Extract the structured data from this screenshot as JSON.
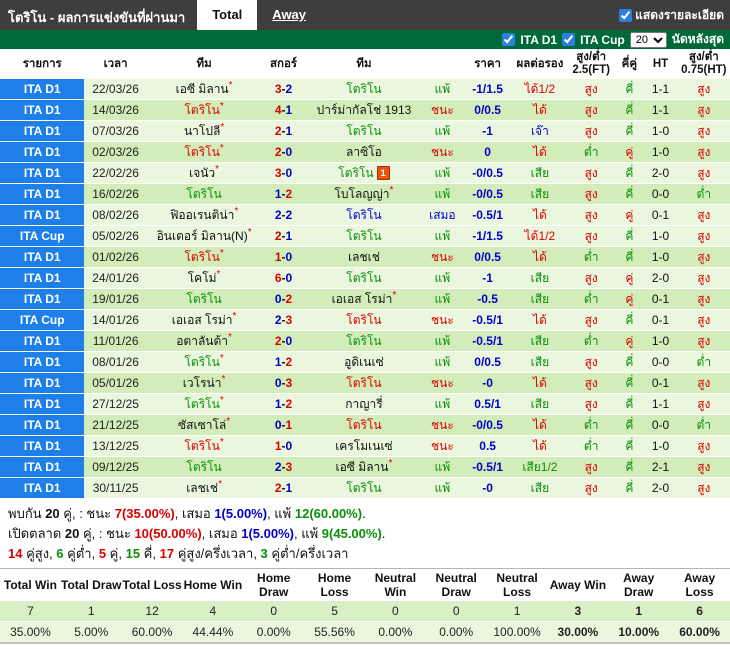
{
  "meta": {
    "star": "*",
    "dash": "-"
  },
  "header": {
    "title": "โตริโน - ผลการแข่งขันที่ผ่านมา",
    "tabs": [
      {
        "label": "Total",
        "active": true
      },
      {
        "label": "Away",
        "active": false
      }
    ],
    "details_checkbox_label": "แสดงรายละเอียด"
  },
  "filter": {
    "leagues": [
      {
        "label": "ITA D1",
        "checked": true
      },
      {
        "label": "ITA Cup",
        "checked": true
      }
    ],
    "count": "20",
    "count_suffix": "นัดหลังสุด"
  },
  "table": {
    "headers": [
      "รายการ",
      "เวลา",
      "ทีม",
      "สกอร์",
      "ทีม",
      "",
      "ราคา",
      "ผลต่อรอง",
      "สูง/ต่ำ 2.5(FT)",
      "คี่คู่",
      "HT",
      "สูง/ต่ำ 0.75(HT)"
    ],
    "rows": [
      {
        "lg": "ITA D1",
        "dt": "22/03/26",
        "h": {
          "n": "เอซี มิลาน",
          "st": 1,
          "c": "k"
        },
        "s": {
          "h": "3",
          "a": "2",
          "hc": "r",
          "ac": "b"
        },
        "a": {
          "n": "โตริโน",
          "c": "g"
        },
        "rw": {
          "t": "แพ้",
          "c": "g"
        },
        "od": "-1/1.5",
        "hd": {
          "t": "ได้1/2",
          "c": "r"
        },
        "ou": {
          "t": "สูง",
          "c": "r"
        },
        "oe": {
          "t": "คี่",
          "c": "g"
        },
        "ht": "1-1",
        "oh": {
          "t": "สูง",
          "c": "r"
        }
      },
      {
        "lg": "ITA D1",
        "dt": "14/03/26",
        "h": {
          "n": "โตริโน",
          "st": 1,
          "c": "r"
        },
        "s": {
          "h": "4",
          "a": "1",
          "hc": "r",
          "ac": "b"
        },
        "a": {
          "n": "ปาร์ม่ากัลโช่ 1913",
          "c": "k"
        },
        "rw": {
          "t": "ชนะ",
          "c": "r"
        },
        "od": "0/0.5",
        "hd": {
          "t": "ได้",
          "c": "r"
        },
        "ou": {
          "t": "สูง",
          "c": "r"
        },
        "oe": {
          "t": "คี่",
          "c": "g"
        },
        "ht": "1-1",
        "oh": {
          "t": "สูง",
          "c": "r"
        }
      },
      {
        "lg": "ITA D1",
        "dt": "07/03/26",
        "h": {
          "n": "นาโปลี",
          "st": 1,
          "c": "k"
        },
        "s": {
          "h": "2",
          "a": "1",
          "hc": "r",
          "ac": "b"
        },
        "a": {
          "n": "โตริโน",
          "c": "g"
        },
        "rw": {
          "t": "แพ้",
          "c": "g"
        },
        "od": "-1",
        "hd": {
          "t": "เจ๊า",
          "c": "b"
        },
        "ou": {
          "t": "สูง",
          "c": "r"
        },
        "oe": {
          "t": "คี่",
          "c": "g"
        },
        "ht": "1-0",
        "oh": {
          "t": "สูง",
          "c": "r"
        }
      },
      {
        "lg": "ITA D1",
        "dt": "02/03/26",
        "h": {
          "n": "โตริโน",
          "st": 1,
          "c": "r"
        },
        "s": {
          "h": "2",
          "a": "0",
          "hc": "r",
          "ac": "b"
        },
        "a": {
          "n": "ลาซิโอ",
          "c": "k"
        },
        "rw": {
          "t": "ชนะ",
          "c": "r"
        },
        "od": "0",
        "hd": {
          "t": "ได้",
          "c": "r"
        },
        "ou": {
          "t": "ต่ำ",
          "c": "g"
        },
        "oe": {
          "t": "คู่",
          "c": "r"
        },
        "ht": "1-0",
        "oh": {
          "t": "สูง",
          "c": "r"
        }
      },
      {
        "lg": "ITA D1",
        "dt": "22/02/26",
        "h": {
          "n": "เจนัว",
          "st": 1,
          "c": "k"
        },
        "s": {
          "h": "3",
          "a": "0",
          "hc": "r",
          "ac": "b"
        },
        "a": {
          "n": "โตริโน",
          "c": "g",
          "card": "1"
        },
        "rw": {
          "t": "แพ้",
          "c": "g"
        },
        "od": "-0/0.5",
        "hd": {
          "t": "เสีย",
          "c": "g"
        },
        "ou": {
          "t": "สูง",
          "c": "r"
        },
        "oe": {
          "t": "คี่",
          "c": "g"
        },
        "ht": "2-0",
        "oh": {
          "t": "สูง",
          "c": "r"
        }
      },
      {
        "lg": "ITA D1",
        "dt": "16/02/26",
        "h": {
          "n": "โตริโน",
          "c": "g"
        },
        "s": {
          "h": "1",
          "a": "2",
          "hc": "b",
          "ac": "r"
        },
        "a": {
          "n": "โบโลญญ่า",
          "st": 1,
          "c": "k"
        },
        "rw": {
          "t": "แพ้",
          "c": "g"
        },
        "od": "-0/0.5",
        "hd": {
          "t": "เสีย",
          "c": "g"
        },
        "ou": {
          "t": "สูง",
          "c": "r"
        },
        "oe": {
          "t": "คี่",
          "c": "g"
        },
        "ht": "0-0",
        "oh": {
          "t": "ต่ำ",
          "c": "g"
        }
      },
      {
        "lg": "ITA D1",
        "dt": "08/02/26",
        "h": {
          "n": "ฟิออเรนติน่า",
          "st": 1,
          "c": "k"
        },
        "s": {
          "h": "2",
          "a": "2",
          "hc": "b",
          "ac": "b"
        },
        "a": {
          "n": "โตริโน",
          "c": "b"
        },
        "rw": {
          "t": "เสมอ",
          "c": "b"
        },
        "od": "-0.5/1",
        "hd": {
          "t": "ได้",
          "c": "r"
        },
        "ou": {
          "t": "สูง",
          "c": "r"
        },
        "oe": {
          "t": "คู่",
          "c": "r"
        },
        "ht": "0-1",
        "oh": {
          "t": "สูง",
          "c": "r"
        }
      },
      {
        "lg": "ITA Cup",
        "dt": "05/02/26",
        "h": {
          "n": "อินเตอร์ มิลาน(N)",
          "st": 1,
          "c": "k"
        },
        "s": {
          "h": "2",
          "a": "1",
          "hc": "r",
          "ac": "b"
        },
        "a": {
          "n": "โตริโน",
          "c": "g"
        },
        "rw": {
          "t": "แพ้",
          "c": "g"
        },
        "od": "-1/1.5",
        "hd": {
          "t": "ได้1/2",
          "c": "r"
        },
        "ou": {
          "t": "สูง",
          "c": "r"
        },
        "oe": {
          "t": "คี่",
          "c": "g"
        },
        "ht": "1-0",
        "oh": {
          "t": "สูง",
          "c": "r"
        }
      },
      {
        "lg": "ITA D1",
        "dt": "01/02/26",
        "h": {
          "n": "โตริโน",
          "st": 1,
          "c": "r"
        },
        "s": {
          "h": "1",
          "a": "0",
          "hc": "r",
          "ac": "b"
        },
        "a": {
          "n": "เลชเช่",
          "c": "k"
        },
        "rw": {
          "t": "ชนะ",
          "c": "r"
        },
        "od": "0/0.5",
        "hd": {
          "t": "ได้",
          "c": "r"
        },
        "ou": {
          "t": "ต่ำ",
          "c": "g"
        },
        "oe": {
          "t": "คี่",
          "c": "g"
        },
        "ht": "1-0",
        "oh": {
          "t": "สูง",
          "c": "r"
        }
      },
      {
        "lg": "ITA D1",
        "dt": "24/01/26",
        "h": {
          "n": "โคโม่",
          "st": 1,
          "c": "k"
        },
        "s": {
          "h": "6",
          "a": "0",
          "hc": "r",
          "ac": "b"
        },
        "a": {
          "n": "โตริโน",
          "c": "g"
        },
        "rw": {
          "t": "แพ้",
          "c": "g"
        },
        "od": "-1",
        "hd": {
          "t": "เสีย",
          "c": "g"
        },
        "ou": {
          "t": "สูง",
          "c": "r"
        },
        "oe": {
          "t": "คู่",
          "c": "r"
        },
        "ht": "2-0",
        "oh": {
          "t": "สูง",
          "c": "r"
        }
      },
      {
        "lg": "ITA D1",
        "dt": "19/01/26",
        "h": {
          "n": "โตริโน",
          "c": "g"
        },
        "s": {
          "h": "0",
          "a": "2",
          "hc": "b",
          "ac": "r"
        },
        "a": {
          "n": "เอเอส โรม่า",
          "st": 1,
          "c": "k"
        },
        "rw": {
          "t": "แพ้",
          "c": "g"
        },
        "od": "-0.5",
        "hd": {
          "t": "เสีย",
          "c": "g"
        },
        "ou": {
          "t": "ต่ำ",
          "c": "g"
        },
        "oe": {
          "t": "คู่",
          "c": "r"
        },
        "ht": "0-1",
        "oh": {
          "t": "สูง",
          "c": "r"
        }
      },
      {
        "lg": "ITA Cup",
        "dt": "14/01/26",
        "h": {
          "n": "เอเอส โรม่า",
          "st": 1,
          "c": "k"
        },
        "s": {
          "h": "2",
          "a": "3",
          "hc": "b",
          "ac": "r"
        },
        "a": {
          "n": "โตริโน",
          "c": "r"
        },
        "rw": {
          "t": "ชนะ",
          "c": "r"
        },
        "od": "-0.5/1",
        "hd": {
          "t": "ได้",
          "c": "r"
        },
        "ou": {
          "t": "สูง",
          "c": "r"
        },
        "oe": {
          "t": "คี่",
          "c": "g"
        },
        "ht": "0-1",
        "oh": {
          "t": "สูง",
          "c": "r"
        }
      },
      {
        "lg": "ITA D1",
        "dt": "11/01/26",
        "h": {
          "n": "อตาลันต้า",
          "st": 1,
          "c": "k"
        },
        "s": {
          "h": "2",
          "a": "0",
          "hc": "r",
          "ac": "b"
        },
        "a": {
          "n": "โตริโน",
          "c": "g"
        },
        "rw": {
          "t": "แพ้",
          "c": "g"
        },
        "od": "-0.5/1",
        "hd": {
          "t": "เสีย",
          "c": "g"
        },
        "ou": {
          "t": "ต่ำ",
          "c": "g"
        },
        "oe": {
          "t": "คู่",
          "c": "r"
        },
        "ht": "1-0",
        "oh": {
          "t": "สูง",
          "c": "r"
        }
      },
      {
        "lg": "ITA D1",
        "dt": "08/01/26",
        "h": {
          "n": "โตริโน",
          "st": 1,
          "c": "g"
        },
        "s": {
          "h": "1",
          "a": "2",
          "hc": "b",
          "ac": "r"
        },
        "a": {
          "n": "อูดิเนเซ่",
          "c": "k"
        },
        "rw": {
          "t": "แพ้",
          "c": "g"
        },
        "od": "0/0.5",
        "hd": {
          "t": "เสีย",
          "c": "g"
        },
        "ou": {
          "t": "สูง",
          "c": "r"
        },
        "oe": {
          "t": "คี่",
          "c": "g"
        },
        "ht": "0-0",
        "oh": {
          "t": "ต่ำ",
          "c": "g"
        }
      },
      {
        "lg": "ITA D1",
        "dt": "05/01/26",
        "h": {
          "n": "เวโรน่า",
          "st": 1,
          "c": "k"
        },
        "s": {
          "h": "0",
          "a": "3",
          "hc": "b",
          "ac": "r"
        },
        "a": {
          "n": "โตริโน",
          "c": "r"
        },
        "rw": {
          "t": "ชนะ",
          "c": "r"
        },
        "od": "-0",
        "hd": {
          "t": "ได้",
          "c": "r"
        },
        "ou": {
          "t": "สูง",
          "c": "r"
        },
        "oe": {
          "t": "คี่",
          "c": "g"
        },
        "ht": "0-1",
        "oh": {
          "t": "สูง",
          "c": "r"
        }
      },
      {
        "lg": "ITA D1",
        "dt": "27/12/25",
        "h": {
          "n": "โตริโน",
          "st": 1,
          "c": "g"
        },
        "s": {
          "h": "1",
          "a": "2",
          "hc": "b",
          "ac": "r"
        },
        "a": {
          "n": "กาญารี่",
          "c": "k"
        },
        "rw": {
          "t": "แพ้",
          "c": "g"
        },
        "od": "0.5/1",
        "hd": {
          "t": "เสีย",
          "c": "g"
        },
        "ou": {
          "t": "สูง",
          "c": "r"
        },
        "oe": {
          "t": "คี่",
          "c": "g"
        },
        "ht": "1-1",
        "oh": {
          "t": "สูง",
          "c": "r"
        }
      },
      {
        "lg": "ITA D1",
        "dt": "21/12/25",
        "h": {
          "n": "ซัสเซาโล่",
          "st": 1,
          "c": "k"
        },
        "s": {
          "h": "0",
          "a": "1",
          "hc": "b",
          "ac": "r"
        },
        "a": {
          "n": "โตริโน",
          "c": "r"
        },
        "rw": {
          "t": "ชนะ",
          "c": "r"
        },
        "od": "-0/0.5",
        "hd": {
          "t": "ได้",
          "c": "r"
        },
        "ou": {
          "t": "ต่ำ",
          "c": "g"
        },
        "oe": {
          "t": "คี่",
          "c": "g"
        },
        "ht": "0-0",
        "oh": {
          "t": "ต่ำ",
          "c": "g"
        }
      },
      {
        "lg": "ITA D1",
        "dt": "13/12/25",
        "h": {
          "n": "โตริโน",
          "st": 1,
          "c": "r"
        },
        "s": {
          "h": "1",
          "a": "0",
          "hc": "r",
          "ac": "b"
        },
        "a": {
          "n": "เครโมเนเซ่",
          "c": "k"
        },
        "rw": {
          "t": "ชนะ",
          "c": "r"
        },
        "od": "0.5",
        "hd": {
          "t": "ได้",
          "c": "r"
        },
        "ou": {
          "t": "ต่ำ",
          "c": "g"
        },
        "oe": {
          "t": "คี่",
          "c": "g"
        },
        "ht": "1-0",
        "oh": {
          "t": "สูง",
          "c": "r"
        }
      },
      {
        "lg": "ITA D1",
        "dt": "09/12/25",
        "h": {
          "n": "โตริโน",
          "c": "g"
        },
        "s": {
          "h": "2",
          "a": "3",
          "hc": "b",
          "ac": "r"
        },
        "a": {
          "n": "เอซี มิลาน",
          "st": 1,
          "c": "k"
        },
        "rw": {
          "t": "แพ้",
          "c": "g"
        },
        "od": "-0.5/1",
        "hd": {
          "t": "เสีย1/2",
          "c": "g"
        },
        "ou": {
          "t": "สูง",
          "c": "r"
        },
        "oe": {
          "t": "คี่",
          "c": "g"
        },
        "ht": "2-1",
        "oh": {
          "t": "สูง",
          "c": "r"
        }
      },
      {
        "lg": "ITA D1",
        "dt": "30/11/25",
        "h": {
          "n": "เลชเช่",
          "st": 1,
          "c": "k"
        },
        "s": {
          "h": "2",
          "a": "1",
          "hc": "r",
          "ac": "b"
        },
        "a": {
          "n": "โตริโน",
          "c": "g"
        },
        "rw": {
          "t": "แพ้",
          "c": "g"
        },
        "od": "-0",
        "hd": {
          "t": "เสีย",
          "c": "g"
        },
        "ou": {
          "t": "สูง",
          "c": "r"
        },
        "oe": {
          "t": "คี่",
          "c": "g"
        },
        "ht": "2-0",
        "oh": {
          "t": "สูง",
          "c": "r"
        }
      }
    ]
  },
  "summary": {
    "lines": [
      {
        "segs": [
          {
            "t": "พบกัน ",
            "c": "k"
          },
          {
            "t": "20",
            "c": "k",
            "b": 1
          },
          {
            "t": " คู่, : ชนะ ",
            "c": "k"
          },
          {
            "t": "7(35.00%)",
            "c": "r",
            "b": 1
          },
          {
            "t": ", เสมอ ",
            "c": "k"
          },
          {
            "t": "1(5.00%)",
            "c": "b",
            "b": 1
          },
          {
            "t": ", แพ้ ",
            "c": "k"
          },
          {
            "t": "12(60.00%)",
            "c": "g",
            "b": 1
          },
          {
            "t": ".",
            "c": "k"
          }
        ]
      },
      {
        "segs": [
          {
            "t": "เปิดตลาด ",
            "c": "k"
          },
          {
            "t": "20",
            "c": "k",
            "b": 1
          },
          {
            "t": " คู่, : ชนะ ",
            "c": "k"
          },
          {
            "t": "10(50.00%)",
            "c": "r",
            "b": 1
          },
          {
            "t": ", เสมอ ",
            "c": "k"
          },
          {
            "t": "1(5.00%)",
            "c": "b",
            "b": 1
          },
          {
            "t": ", แพ้ ",
            "c": "k"
          },
          {
            "t": "9(45.00%)",
            "c": "g",
            "b": 1
          },
          {
            "t": ".",
            "c": "k"
          }
        ]
      },
      {
        "segs": [
          {
            "t": "14",
            "c": "r",
            "b": 1
          },
          {
            "t": " คู่สูง, ",
            "c": "k"
          },
          {
            "t": "6",
            "c": "g",
            "b": 1
          },
          {
            "t": " คู่ต่ำ, ",
            "c": "k"
          },
          {
            "t": "5",
            "c": "r",
            "b": 1
          },
          {
            "t": " คู่, ",
            "c": "k"
          },
          {
            "t": "15",
            "c": "g",
            "b": 1
          },
          {
            "t": " คี่, ",
            "c": "k"
          },
          {
            "t": "17",
            "c": "r",
            "b": 1
          },
          {
            "t": " คู่สูง/ครึ่งเวลา, ",
            "c": "k"
          },
          {
            "t": "3",
            "c": "g",
            "b": 1
          },
          {
            "t": " คู่ต่ำ/ครึ่งเวลา",
            "c": "k"
          }
        ]
      }
    ]
  },
  "stats": {
    "columns": [
      "Total Win",
      "Total Draw",
      "Total Loss",
      "Home Win",
      "Home Draw",
      "Home Loss",
      "Neutral Win",
      "Neutral Draw",
      "Neutral Loss",
      "Away Win",
      "Away Draw",
      "Away Loss"
    ],
    "counts": [
      "7",
      "1",
      "12",
      "4",
      "0",
      "5",
      "0",
      "0",
      "1",
      "3",
      "1",
      "6"
    ],
    "percents": [
      "35.00%",
      "5.00%",
      "60.00%",
      "44.44%",
      "0.00%",
      "55.56%",
      "0.00%",
      "0.00%",
      "100.00%",
      "30.00%",
      "10.00%",
      "60.00%"
    ],
    "away_start_index": 9,
    "away_color": "#0000cc"
  },
  "colors": {
    "accent_blue": "#1f7fe8",
    "bar_green": "#00693a",
    "win_red": "#dd0000",
    "loss_green": "#0a8f0a",
    "draw_blue": "#0000cc"
  }
}
